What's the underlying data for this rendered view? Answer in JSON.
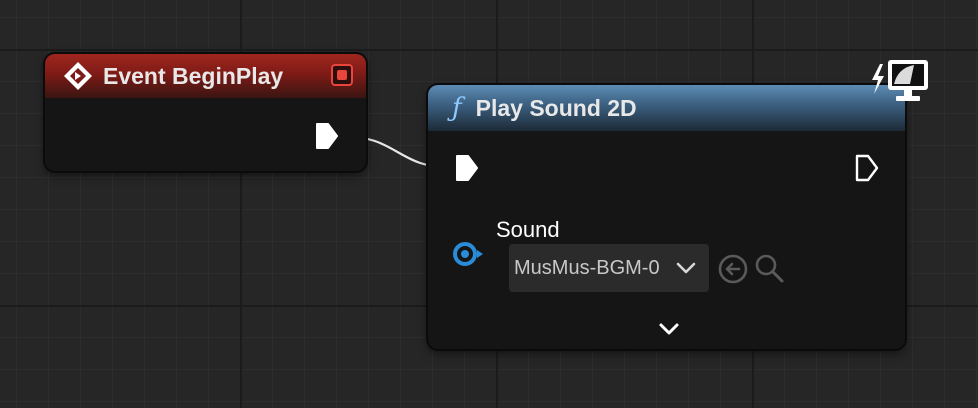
{
  "graph": {
    "event_node": {
      "title": "Event BeginPlay",
      "icon": "event-diamond-icon",
      "stop_icon": "stop-icon",
      "header_color": "#a0261f"
    },
    "function_node": {
      "title": "Play Sound 2D",
      "function_symbol": "ƒ",
      "header_color": "#4e7aa2",
      "context_icon": "client-only-monitor-icon",
      "sound_pin": {
        "label": "Sound",
        "selected_asset": "MusMus-BGM-0",
        "pin_color": "#2a8cd8"
      },
      "advanced_toggle": "chevron-down-icon"
    },
    "wire_color": "#e6e6e6"
  }
}
